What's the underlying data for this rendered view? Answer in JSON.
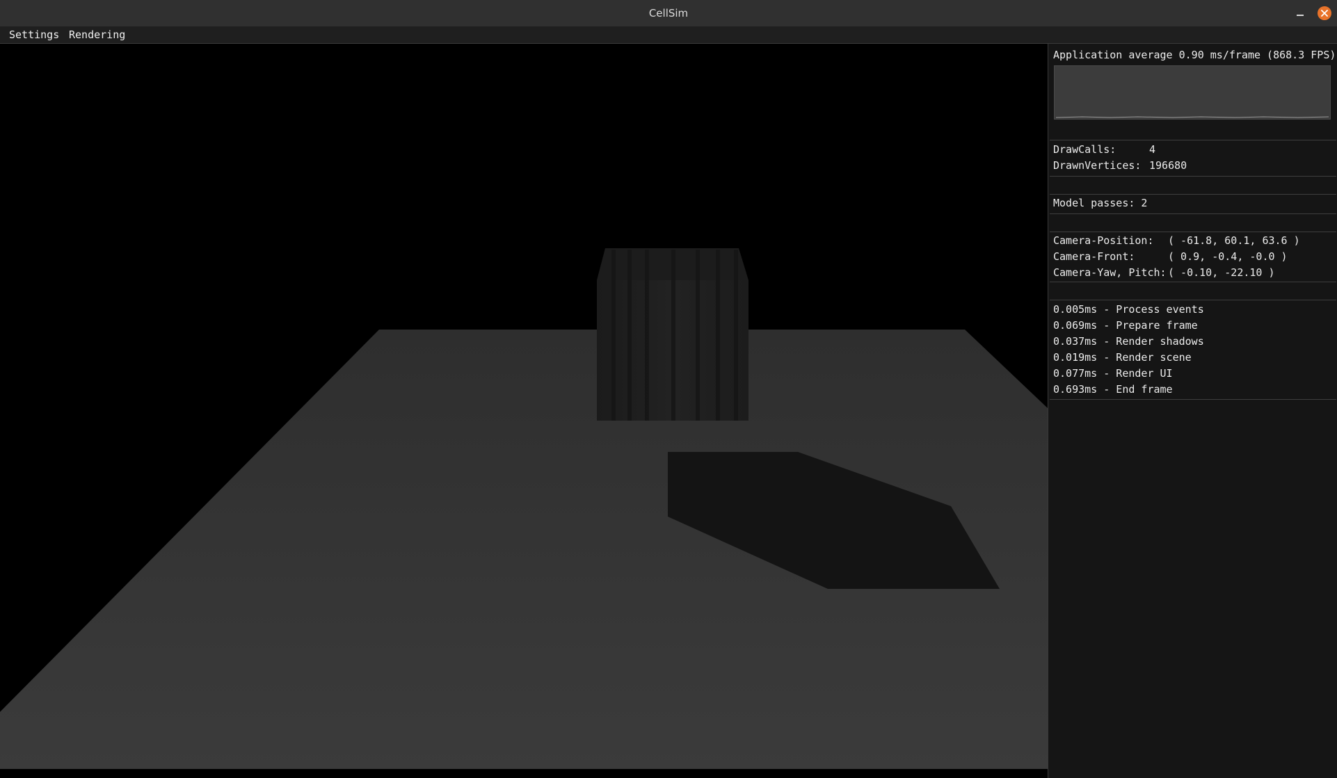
{
  "window": {
    "title": "CellSim"
  },
  "menu": {
    "items": [
      "Settings",
      "Rendering"
    ]
  },
  "stats": {
    "app_average": "Application average 0.90 ms/frame (868.3 FPS)",
    "draw_calls_label": "DrawCalls:",
    "draw_calls_value": "4",
    "drawn_vertices_label": "DrawnVertices:",
    "drawn_vertices_value": "196680",
    "model_passes": "Model passes: 2",
    "camera_position_label": "Camera-Position:",
    "camera_position_value": "( -61.8, 60.1, 63.6 )",
    "camera_front_label": "Camera-Front:",
    "camera_front_value": "( 0.9, -0.4, -0.0 )",
    "camera_yaw_pitch_label": "Camera-Yaw, Pitch:",
    "camera_yaw_pitch_value": "( -0.10, -22.10 )"
  },
  "timings": [
    "0.005ms - Process events",
    "0.069ms - Prepare frame",
    "0.037ms - Render shadows",
    "0.019ms - Render scene",
    "0.077ms - Render UI",
    "0.693ms - End frame"
  ],
  "colors": {
    "close_button": "#e9732a",
    "viewport_background": "#000000",
    "floor": "#3a3a3a",
    "panel_background": "#151515"
  }
}
